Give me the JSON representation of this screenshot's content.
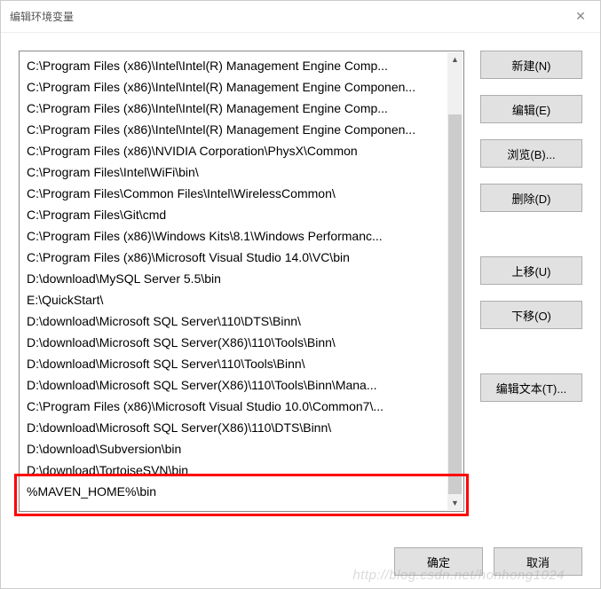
{
  "window": {
    "title": "编辑环境变量"
  },
  "list": {
    "items": [
      "C:\\Program Files (x86)\\Intel\\Intel(R) Management Engine Comp...",
      "C:\\Program Files (x86)\\Intel\\Intel(R) Management Engine Componen...",
      "C:\\Program Files (x86)\\Intel\\Intel(R) Management Engine Comp...",
      "C:\\Program Files (x86)\\Intel\\Intel(R) Management Engine Componen...",
      "C:\\Program Files (x86)\\NVIDIA Corporation\\PhysX\\Common",
      "C:\\Program Files\\Intel\\WiFi\\bin\\",
      "C:\\Program Files\\Common Files\\Intel\\WirelessCommon\\",
      "C:\\Program Files\\Git\\cmd",
      "C:\\Program Files (x86)\\Windows Kits\\8.1\\Windows Performanc...",
      "C:\\Program Files (x86)\\Microsoft Visual Studio 14.0\\VC\\bin",
      "D:\\download\\MySQL Server 5.5\\bin",
      "E:\\QuickStart\\",
      "D:\\download\\Microsoft SQL Server\\110\\DTS\\Binn\\",
      "D:\\download\\Microsoft SQL Server(X86)\\110\\Tools\\Binn\\",
      "D:\\download\\Microsoft SQL Server\\110\\Tools\\Binn\\",
      "D:\\download\\Microsoft SQL Server(X86)\\110\\Tools\\Binn\\Mana...",
      "C:\\Program Files (x86)\\Microsoft Visual Studio 10.0\\Common7\\...",
      "D:\\download\\Microsoft SQL Server(X86)\\110\\DTS\\Binn\\",
      "D:\\download\\Subversion\\bin",
      "D:\\download\\TortoiseSVN\\bin",
      "%MAVEN_HOME%\\bin"
    ]
  },
  "buttons": {
    "new": "新建(N)",
    "edit": "编辑(E)",
    "browse": "浏览(B)...",
    "delete": "删除(D)",
    "moveUp": "上移(U)",
    "moveDown": "下移(O)",
    "editText": "编辑文本(T)...",
    "ok": "确定",
    "cancel": "取消"
  },
  "watermark": "http://blog.csdn.net/honhong1024"
}
